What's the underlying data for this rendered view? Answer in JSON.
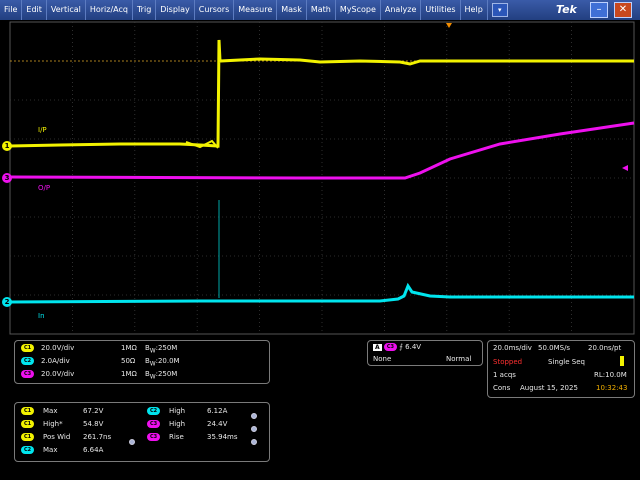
{
  "menu": {
    "items": [
      "File",
      "Edit",
      "Vertical",
      "Horiz/Acq",
      "Trig",
      "Display",
      "Cursors",
      "Measure",
      "Mask",
      "Math",
      "MyScope",
      "Analyze",
      "Utilities",
      "Help"
    ],
    "dropdown_icon": "▾",
    "brand": "Tek",
    "minimize_icon": "–",
    "close_icon": "✕"
  },
  "colors": {
    "ch1": "#f2f200",
    "ch2": "#00e5ee",
    "ch3": "#ee10ee",
    "grid": "#3a3a3a",
    "background": "#000000"
  },
  "traces": {
    "ch1_label": "I/P",
    "ch3_label": "O/P",
    "ch2_label": "In",
    "ch1_marker": "1",
    "ch3_marker": "3",
    "ch2_marker": "2"
  },
  "channels": [
    {
      "badge": "C1",
      "scale": "20.0V/div",
      "coupling": "1MΩ",
      "bw": "250M"
    },
    {
      "badge": "C2",
      "scale": "2.0A/div",
      "coupling": "50Ω",
      "bw": "20.0M"
    },
    {
      "badge": "C3",
      "scale": "20.0V/div",
      "coupling": "1MΩ",
      "bw": "250M"
    }
  ],
  "bw_symbol": "B",
  "bw_sub": "W",
  "bw_sep": ":",
  "trigger": {
    "mode_badge": "A",
    "source_badge": "C3",
    "edge_icon": "⨍",
    "level": "6.4V",
    "left": "None",
    "right": "Normal"
  },
  "acquisition": {
    "timebase": "20.0ms/div",
    "sample_rate": "50.0MS/s",
    "resolution": "20.0ns/pt",
    "status": "Stopped",
    "seq_mode": "Single Seq",
    "acqs": "1 acqs",
    "record_length": "RL:10.0M",
    "mode": "Cons",
    "date": "August 15, 2025",
    "time": "10:32:43"
  },
  "measurements": [
    {
      "badge": "C1",
      "name": "Max",
      "value": "67.2V",
      "badge2": "C2",
      "name2": "High",
      "value2": "6.12A"
    },
    {
      "badge": "C1",
      "name": "High*",
      "value": "54.8V",
      "badge2": "C3",
      "name2": "High",
      "value2": "24.4V"
    },
    {
      "badge": "C1",
      "name": "Pos Wid",
      "value": "261.7ns",
      "badge2": "C3",
      "name2": "Rise",
      "value2": "35.94ms"
    },
    {
      "badge": "C2",
      "name": "Max",
      "value": "6.64A"
    }
  ]
}
